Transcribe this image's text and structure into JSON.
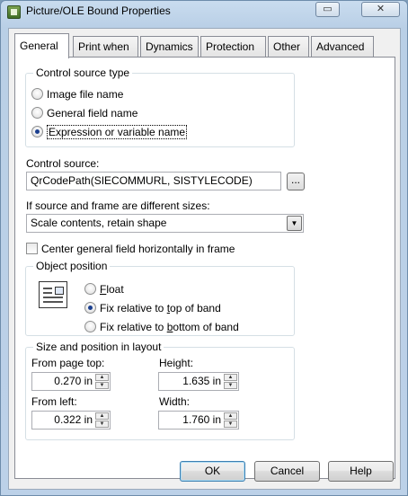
{
  "window": {
    "title": "Picture/OLE Bound Properties",
    "help_glyph": "▭",
    "close_glyph": "✕"
  },
  "tabs": [
    {
      "label": "General",
      "active": true
    },
    {
      "label": "Print when"
    },
    {
      "label": "Dynamics"
    },
    {
      "label": "Protection"
    },
    {
      "label": "Other"
    },
    {
      "label": "Advanced"
    }
  ],
  "control_source_type": {
    "label": "Control source type",
    "options": [
      {
        "label": "Image file name",
        "selected": false
      },
      {
        "label": "General field name",
        "selected": false
      },
      {
        "label": "Expression or variable name",
        "selected": true
      }
    ]
  },
  "control_source": {
    "label": "Control source:",
    "value": "QrCodePath(SIECOMMURL, SISTYLECODE)",
    "browse_label": "..."
  },
  "size_mode": {
    "label": "If source and frame are different sizes:",
    "value": "Scale contents, retain shape"
  },
  "center_checkbox": {
    "label": "Center general field horizontally in frame",
    "checked": false
  },
  "object_position": {
    "label": "Object position",
    "options": [
      {
        "pre": "",
        "accel": "F",
        "post": "loat",
        "selected": false
      },
      {
        "pre": "Fix relative to ",
        "accel": "t",
        "post": "op of band",
        "selected": true
      },
      {
        "pre": "Fix relative to ",
        "accel": "b",
        "post": "ottom of band",
        "selected": false
      }
    ]
  },
  "size_position": {
    "label": "Size and position in layout",
    "from_top": {
      "label": "From page top:",
      "value": "0.270 in"
    },
    "height": {
      "label": "Height:",
      "value": "1.635 in"
    },
    "from_left": {
      "label": "From left:",
      "value": "0.322 in"
    },
    "width": {
      "label": "Width:",
      "value": "1.760 in"
    }
  },
  "buttons": {
    "ok": "OK",
    "cancel": "Cancel",
    "help": "Help"
  }
}
